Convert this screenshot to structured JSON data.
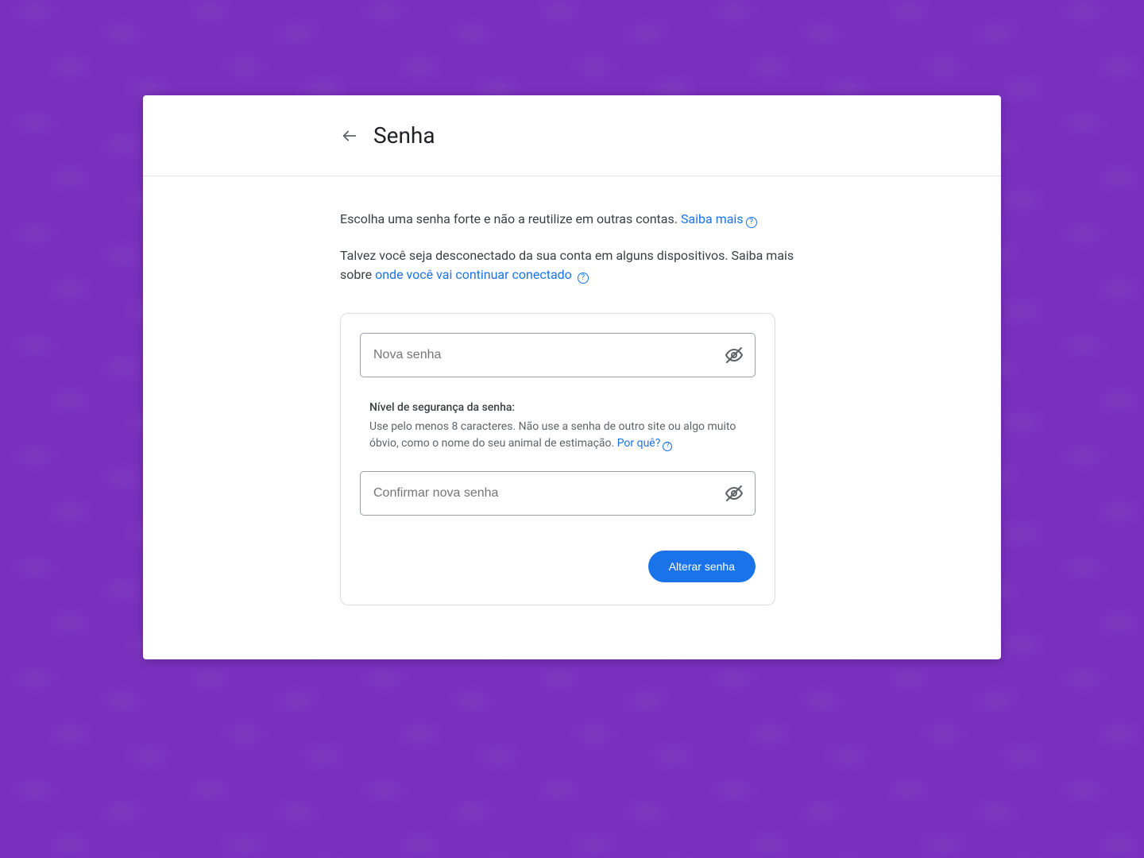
{
  "header": {
    "title": "Senha"
  },
  "description": {
    "line1_before_link": "Escolha uma senha forte e não a reutilize em outras contas. ",
    "line1_link": "Saiba mais",
    "line2_before_link": "Talvez você seja desconectado da sua conta em alguns dispositivos. Saiba mais sobre ",
    "line2_link": "onde você vai continuar conectado"
  },
  "form": {
    "new_password_placeholder": "Nova senha",
    "confirm_password_placeholder": "Confirmar nova senha",
    "strength_title": "Nível de segurança da senha:",
    "strength_text_before_link": "Use pelo menos 8 caracteres. Não use a senha de outro site ou algo muito óbvio, como o nome do seu animal de estimação. ",
    "strength_link": "Por quê?",
    "submit_label": "Alterar senha"
  },
  "colors": {
    "accent": "#1a73e8",
    "bg": "#7a2fbd"
  }
}
